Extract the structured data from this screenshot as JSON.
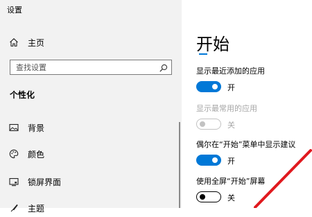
{
  "window": {
    "title": "设置"
  },
  "sidebar": {
    "home_label": "主页",
    "search_placeholder": "查找设置",
    "section_title": "个性化",
    "items": [
      {
        "label": "背景",
        "icon": "image-icon"
      },
      {
        "label": "颜色",
        "icon": "palette-icon"
      },
      {
        "label": "锁屏界面",
        "icon": "lock-screen-icon"
      },
      {
        "label": "主题",
        "icon": "theme-icon"
      }
    ]
  },
  "main": {
    "title": "开始",
    "settings": [
      {
        "label": "显示最近添加的应用",
        "state": "开",
        "on": true,
        "enabled": true
      },
      {
        "label": "显示最常用的应用",
        "state": "关",
        "on": false,
        "enabled": false
      },
      {
        "label": "偶尔在“开始”菜单中显示建议",
        "state": "开",
        "on": true,
        "enabled": true
      },
      {
        "label": "使用全屏“开始”屏幕",
        "state": "关",
        "on": false,
        "enabled": true
      }
    ]
  },
  "colors": {
    "accent": "#0078d7",
    "sidebar_bg": "#f2f2f2",
    "annotation": "#e0191e"
  }
}
